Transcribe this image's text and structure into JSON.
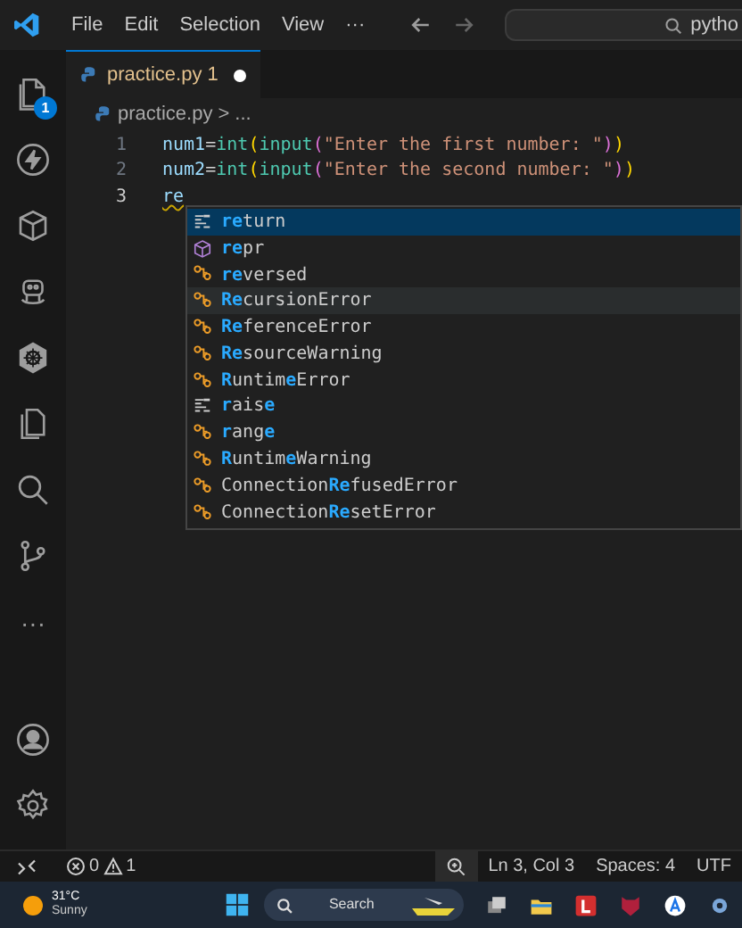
{
  "menu": [
    "File",
    "Edit",
    "Selection",
    "View",
    "···"
  ],
  "command_center": {
    "value": "pytho"
  },
  "activity_bar": [
    {
      "kind": "files",
      "badge": "1"
    },
    {
      "kind": "bolt"
    },
    {
      "kind": "box"
    },
    {
      "kind": "robot"
    },
    {
      "kind": "wheel"
    },
    {
      "kind": "pages"
    },
    {
      "kind": "search"
    },
    {
      "kind": "git"
    },
    {
      "kind": "more",
      "text": "···"
    }
  ],
  "activity_bottom": [
    {
      "kind": "account"
    },
    {
      "kind": "gear"
    }
  ],
  "tabs": [
    {
      "label": "practice.py",
      "problems": "1",
      "modified": true,
      "selected": true
    }
  ],
  "breadcrumb": {
    "file": "practice.py",
    "sep": ">",
    "rest": "..."
  },
  "lines": [
    {
      "number": "1",
      "tokens": [
        {
          "kind": "var",
          "text": "num1"
        },
        {
          "kind": "op",
          "text": "="
        },
        {
          "kind": "func",
          "text": "int"
        },
        {
          "kind": "paren",
          "text": "("
        },
        {
          "kind": "func",
          "text": "input"
        },
        {
          "kind": "paren2",
          "text": "("
        },
        {
          "kind": "str",
          "text": "\"Enter the first number: \""
        },
        {
          "kind": "paren2",
          "text": ")"
        },
        {
          "kind": "paren",
          "text": ")"
        }
      ]
    },
    {
      "number": "2",
      "tokens": [
        {
          "kind": "var",
          "text": "num2"
        },
        {
          "kind": "op",
          "text": "="
        },
        {
          "kind": "func",
          "text": "int"
        },
        {
          "kind": "paren",
          "text": "("
        },
        {
          "kind": "func",
          "text": "input"
        },
        {
          "kind": "paren2",
          "text": "("
        },
        {
          "kind": "str",
          "text": "\"Enter the second number: \""
        },
        {
          "kind": "paren2",
          "text": ")"
        },
        {
          "kind": "paren",
          "text": ")"
        }
      ]
    },
    {
      "number": "3",
      "tokens": [
        {
          "kind": "squiggle",
          "text": "re"
        }
      ]
    }
  ],
  "suggestions": [
    {
      "kind": "keyword",
      "selected": true,
      "hovered": false,
      "parts": [
        {
          "text": "re",
          "match": true
        },
        {
          "text": "turn",
          "match": false
        }
      ]
    },
    {
      "kind": "function",
      "selected": false,
      "hovered": false,
      "parts": [
        {
          "text": "re",
          "match": true
        },
        {
          "text": "pr",
          "match": false
        }
      ]
    },
    {
      "kind": "class",
      "selected": false,
      "hovered": false,
      "parts": [
        {
          "text": "re",
          "match": true
        },
        {
          "text": "versed",
          "match": false
        }
      ]
    },
    {
      "kind": "class",
      "selected": false,
      "hovered": true,
      "parts": [
        {
          "text": "Re",
          "match": true
        },
        {
          "text": "cursionError",
          "match": false
        }
      ]
    },
    {
      "kind": "class",
      "selected": false,
      "hovered": false,
      "parts": [
        {
          "text": "Re",
          "match": true
        },
        {
          "text": "ferenceError",
          "match": false
        }
      ]
    },
    {
      "kind": "class",
      "selected": false,
      "hovered": false,
      "parts": [
        {
          "text": "Re",
          "match": true
        },
        {
          "text": "sourceWarning",
          "match": false
        }
      ]
    },
    {
      "kind": "class",
      "selected": false,
      "hovered": false,
      "parts": [
        {
          "text": "R",
          "match": true
        },
        {
          "text": "untim",
          "match": false
        },
        {
          "text": "e",
          "match": true
        },
        {
          "text": "Error",
          "match": false
        }
      ]
    },
    {
      "kind": "keyword",
      "selected": false,
      "hovered": false,
      "parts": [
        {
          "text": "r",
          "match": true
        },
        {
          "text": "ais",
          "match": false
        },
        {
          "text": "e",
          "match": true
        }
      ]
    },
    {
      "kind": "class",
      "selected": false,
      "hovered": false,
      "parts": [
        {
          "text": "r",
          "match": true
        },
        {
          "text": "ang",
          "match": false
        },
        {
          "text": "e",
          "match": true
        }
      ]
    },
    {
      "kind": "class",
      "selected": false,
      "hovered": false,
      "parts": [
        {
          "text": "R",
          "match": true
        },
        {
          "text": "untim",
          "match": false
        },
        {
          "text": "e",
          "match": true
        },
        {
          "text": "Warning",
          "match": false
        }
      ]
    },
    {
      "kind": "class",
      "selected": false,
      "hovered": false,
      "parts": [
        {
          "text": "Connection",
          "match": false
        },
        {
          "text": "Re",
          "match": true
        },
        {
          "text": "fusedError",
          "match": false
        }
      ]
    },
    {
      "kind": "class",
      "selected": false,
      "hovered": false,
      "parts": [
        {
          "text": "Connection",
          "match": false
        },
        {
          "text": "Re",
          "match": true
        },
        {
          "text": "setError",
          "match": false
        }
      ]
    }
  ],
  "status_bar": {
    "errors": "0",
    "warnings": "1",
    "items": [
      "Ln 3, Col 3",
      "Spaces: 4",
      "UTF"
    ]
  },
  "taskbar": {
    "temperature": "31°C",
    "weather": "Sunny",
    "search": "Search",
    "apps": [
      {
        "kind": "start"
      },
      {
        "kind": "stack"
      },
      {
        "kind": "folder"
      },
      {
        "kind": "l-app"
      },
      {
        "kind": "shield"
      },
      {
        "kind": "a-app"
      },
      {
        "kind": "gear"
      }
    ]
  }
}
